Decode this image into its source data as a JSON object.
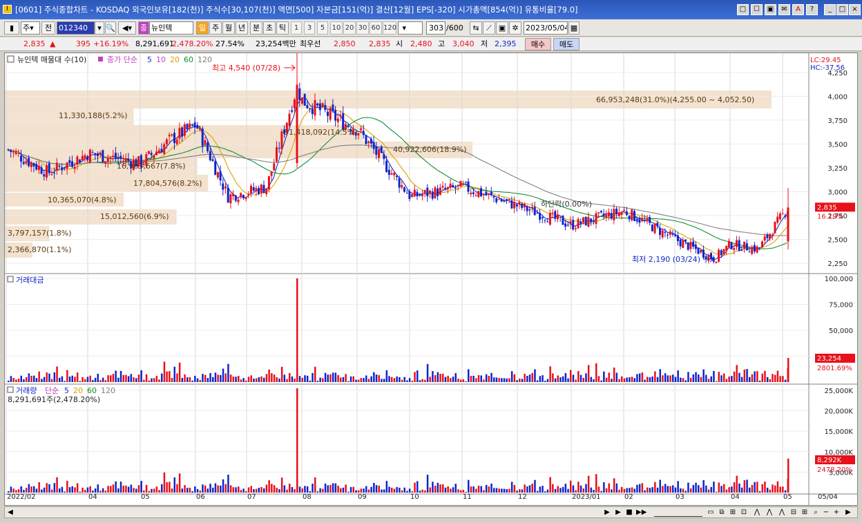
{
  "window": {
    "title": "[0601] 주식종합차트 - KOSDAQ 외국인보유[182(천)] 주식수[30,107(천)] 액면[500] 자본금[151(억)] 결산[12월] EPS[-320] 시가총액[854(억)] 유통비율[79.0]",
    "buttons": [
      "□",
      "☐",
      "▣",
      "✉",
      "A",
      "?",
      "_",
      "□",
      "×"
    ]
  },
  "toolbar": {
    "market_select": "주",
    "prev_label": "전",
    "code": "012340",
    "name_tag": "종",
    "stock_name": "뉴인텍",
    "periods": [
      "일",
      "주",
      "월",
      "년",
      "분",
      "초",
      "틱"
    ],
    "active_period": "일",
    "intervals": [
      "1",
      "3",
      "5",
      "10",
      "20",
      "30",
      "60",
      "120"
    ],
    "count": "303",
    "count_total": "/600",
    "date": "2023/05/04"
  },
  "quote": {
    "price": "2,835",
    "change_sign": "▲",
    "change": "395",
    "change_pct": "+16.19%",
    "volume": "8,291,691",
    "volume_pct": "2,478.20%",
    "turnover": "27.54%",
    "amount": "23,254백만",
    "best_ask_label": "최우선",
    "best_ask": "2,850",
    "best_bid": "2,835",
    "open_label": "시",
    "open": "2,480",
    "high_label": "고",
    "high": "3,040",
    "low_label": "저",
    "low": "2,395",
    "buy_label": "매수",
    "sell_label": "매도"
  },
  "price_panel": {
    "legend_overlay": "뉴인텍 매물대 수(10)",
    "legend_ma": "종가 단순",
    "ma_periods": [
      "5",
      "10",
      "20",
      "60",
      "120"
    ],
    "lc": "LC:29.45",
    "hc": "HC:-37.56",
    "high_note": "최고 4,540 (07/28)",
    "low_note": "최저 2,190 (03/24)",
    "last_price_tag": "2,835",
    "last_pct_tag": "16.19%",
    "zero_label": "하단락(0.00%)",
    "y_ticks": [
      "4,250",
      "4,000",
      "3,750",
      "3,500",
      "3,250",
      "3,000",
      "2,750",
      "2,500",
      "2,250"
    ],
    "volume_profile": [
      {
        "label": "66,953,248(31.0%)(4,255.00 ~ 4,052.50)",
        "frac": 1.0
      },
      {
        "label": "11,330,188(5.2%)",
        "frac": 0.168
      },
      {
        "label": "31,418,092(14.5%)",
        "frac": 0.467
      },
      {
        "label": "40,922,606(18.9%)",
        "frac": 0.61
      },
      {
        "label": "16,903,667(7.8%)",
        "frac": 0.251
      },
      {
        "label": "17,804,576(8.2%)",
        "frac": 0.265
      },
      {
        "label": "10,365,070(4.8%)",
        "frac": 0.155
      },
      {
        "label": "15,012,560(6.9%)",
        "frac": 0.224
      },
      {
        "label": "3,797,157(1.8%)",
        "frac": 0.058
      },
      {
        "label": "2,366,870(1.1%)",
        "frac": 0.036
      }
    ]
  },
  "amount_panel": {
    "title": "거래대금",
    "y_ticks": [
      "100,000",
      "75,000",
      "50,000",
      "25,000"
    ],
    "last_tag": "23,254",
    "last_pct": "2801.69%"
  },
  "volume_panel": {
    "title": "거래량",
    "ma_label": "단순",
    "ma_periods": [
      "5",
      "20",
      "60",
      "120"
    ],
    "summary": "8,291,691주(2,478.20%)",
    "y_ticks": [
      "25,000K",
      "20,000K",
      "15,000K",
      "10,000K",
      "5,000K"
    ],
    "last_tag": "8,292K",
    "last_pct": "2478.20%"
  },
  "x_axis": [
    "2022/02",
    "04",
    "05",
    "06",
    "07",
    "08",
    "09",
    "10",
    "11",
    "12",
    "2023/01",
    "02",
    "03",
    "04",
    "05",
    "05/04"
  ],
  "colors": {
    "up": "#e8101a",
    "down": "#1025c8",
    "ma5": "#2030c0",
    "ma10": "#d040d0",
    "ma20": "#e0a000",
    "ma60": "#109030",
    "ma120": "#808080",
    "profile": "#f2e2cf"
  },
  "chart_data": {
    "type": "candlestick",
    "title": "뉴인텍 일봉",
    "period": "2022/02 – 2023/05/04",
    "last": {
      "open": 2480,
      "high": 3040,
      "low": 2395,
      "close": 2835,
      "change": 395,
      "change_pct": 16.19
    },
    "high": {
      "value": 4540,
      "date": "07/28"
    },
    "low": {
      "value": 2190,
      "date": "03/24"
    },
    "close_path": [
      {
        "x": "2022/02",
        "y": 3450
      },
      {
        "x": "2022/03",
        "y": 3200
      },
      {
        "x": "2022/04",
        "y": 3400
      },
      {
        "x": "2022/05",
        "y": 3300
      },
      {
        "x": "2022/05/20",
        "y": 3550
      },
      {
        "x": "2022/06",
        "y": 3700
      },
      {
        "x": "2022/06/25",
        "y": 2950
      },
      {
        "x": "2022/07/15",
        "y": 3050
      },
      {
        "x": "2022/07/28",
        "y": 4100
      },
      {
        "x": "2022/08",
        "y": 3950
      },
      {
        "x": "2022/09",
        "y": 3650
      },
      {
        "x": "2022/10",
        "y": 2950
      },
      {
        "x": "2022/11",
        "y": 3050
      },
      {
        "x": "2022/12",
        "y": 2850
      },
      {
        "x": "2023/01",
        "y": 2650
      },
      {
        "x": "2023/02",
        "y": 2800
      },
      {
        "x": "2023/03",
        "y": 2500
      },
      {
        "x": "2023/03/24",
        "y": 2300
      },
      {
        "x": "2023/04",
        "y": 2450
      },
      {
        "x": "2023/04/20",
        "y": 2400
      },
      {
        "x": "2023/05/04",
        "y": 2835
      }
    ],
    "ylim": [
      2190,
      4540
    ]
  }
}
